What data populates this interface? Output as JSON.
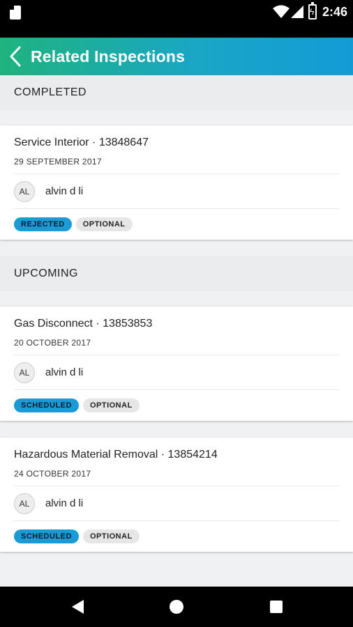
{
  "status_bar": {
    "time": "2:46"
  },
  "app_bar": {
    "title": "Related Inspections"
  },
  "sections": [
    {
      "label": "COMPLETED",
      "cards": [
        {
          "title": "Service Interior · 13848647",
          "date": "29 SEPTEMBER 2017",
          "avatar": "AL",
          "person": "alvin d li",
          "status": "REJECTED",
          "tag": "OPTIONAL"
        }
      ]
    },
    {
      "label": "UPCOMING",
      "cards": [
        {
          "title": "Gas Disconnect · 13853853",
          "date": "20 OCTOBER 2017",
          "avatar": "AL",
          "person": "alvin d li",
          "status": "SCHEDULED",
          "tag": "OPTIONAL"
        },
        {
          "title": "Hazardous Material Removal · 13854214",
          "date": "24 OCTOBER 2017",
          "avatar": "AL",
          "person": "alvin d li",
          "status": "SCHEDULED",
          "tag": "OPTIONAL"
        }
      ]
    }
  ],
  "colors": {
    "accent": "#1c9ad6",
    "header_start": "#1fb37e",
    "header_end": "#139bd6"
  },
  "icons": {
    "back": "chevron-left-icon",
    "wifi": "wifi-icon",
    "signal": "signal-icon",
    "battery": "battery-charging-icon",
    "sd_card": "sd-card-icon"
  }
}
